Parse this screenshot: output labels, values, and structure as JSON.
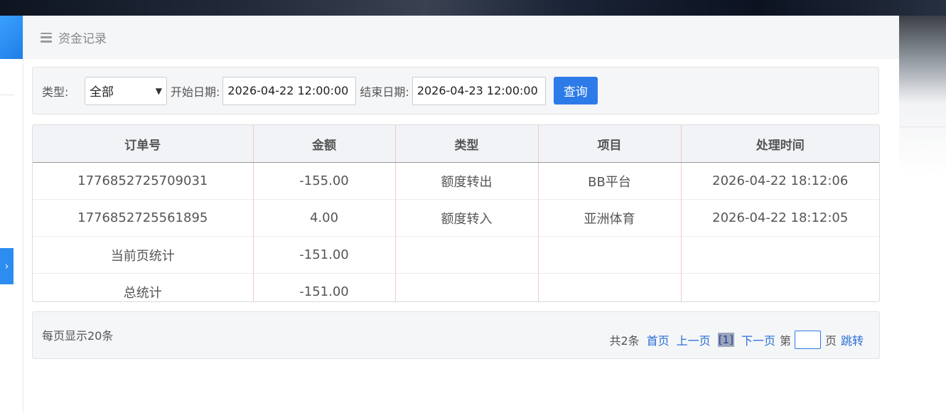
{
  "header": {
    "title": "资金记录"
  },
  "filter": {
    "type_label": "类型:",
    "type_value": "全部",
    "start_label": "开始日期:",
    "start_value": "2026-04-22 12:00:00",
    "end_label": "结束日期:",
    "end_value": "2026-04-23 12:00:00",
    "query_label": "查询"
  },
  "table": {
    "columns": [
      "订单号",
      "金额",
      "类型",
      "项目",
      "处理时间"
    ],
    "rows": [
      [
        "1776852725709031",
        "-155.00",
        "额度转出",
        "BB平台",
        "2026-04-22 18:12:06"
      ],
      [
        "1776852725561895",
        "4.00",
        "额度转入",
        "亚洲体育",
        "2026-04-22 18:12:05"
      ],
      [
        "当前页统计",
        "-151.00",
        "",
        "",
        ""
      ],
      [
        "总统计",
        "-151.00",
        "",
        "",
        ""
      ]
    ]
  },
  "pager": {
    "per_page": "每页显示20条",
    "total": "共2条",
    "first": "首页",
    "prev": "上一页",
    "current": "[1]",
    "next": "下一页",
    "page_prefix": "第",
    "page_suffix": "页",
    "jump": "跳转"
  },
  "colors": {
    "accent": "#2d7be8",
    "link": "#2a6fd6",
    "header_bg": "#f5f6f8"
  },
  "icons": {
    "menu": "menu-icon",
    "sidebar_toggle": "chevron-right-icon",
    "select_arrow": "chevron-down-icon"
  }
}
